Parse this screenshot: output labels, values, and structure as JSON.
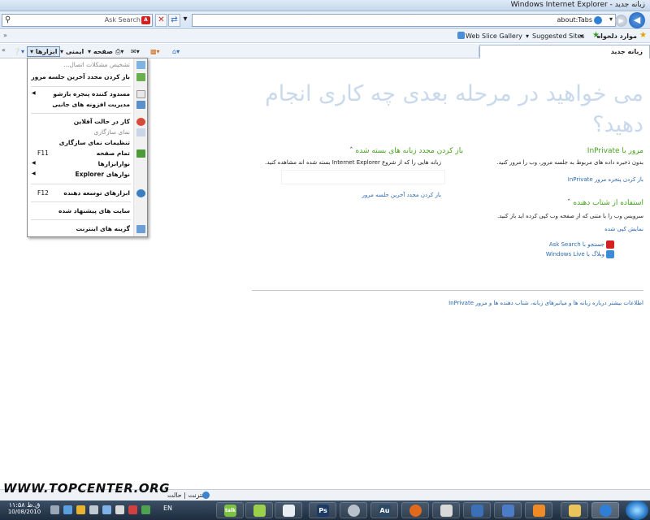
{
  "window": {
    "title": "زبانه جدید - Windows Internet Explorer"
  },
  "address_bar": {
    "url": "about:Tabs"
  },
  "search": {
    "provider": "Ask Search",
    "icon": "search-icon"
  },
  "favorites_bar": {
    "label": "موارد دلخواه",
    "items": [
      "Suggested Sites",
      "Web Slice Gallery"
    ]
  },
  "tab": {
    "title": "زبانه جدید"
  },
  "command_bar": {
    "page": "صفحه",
    "safety": "ایمنی",
    "tools": "ابزارها",
    "help_icon": "help-icon"
  },
  "tools_menu": {
    "items": [
      {
        "label": "تشخیص مشکلات اتصال...",
        "disabled": true
      },
      {
        "label": "باز کردن مجدد آخرین جلسه مرور"
      },
      {
        "label": "مسدود کننده پنجره بازشو",
        "submenu": true
      },
      {
        "label": "مدیریت افزونه های جانبی"
      },
      {
        "label": "کار در حالت آفلاین"
      },
      {
        "label": "نمای سازگاری",
        "disabled": true
      },
      {
        "label": "تنظیمات نمای سازگاری"
      },
      {
        "label": "تمام صفحه",
        "shortcut": "F11"
      },
      {
        "label": "نوارابزارها",
        "submenu": true
      },
      {
        "label": "نوارهای Explorer",
        "submenu": true
      },
      {
        "label": "ابزارهای توسعه دهنده",
        "shortcut": "F12"
      },
      {
        "label": "سایت های پیشنهاد شده"
      },
      {
        "label": "گزینه های اینترنت"
      }
    ]
  },
  "new_tab_page": {
    "heading": "می خواهید در مرحله بعدی چه کاری انجام دهید؟",
    "inprivate": {
      "title": "مرور با InPrivate",
      "body": "بدون ذخیره داده های مربوط به جلسه مرور، وب را مرور کنید.",
      "link": "باز کردن پنجره مرور InPrivate"
    },
    "reopen": {
      "title": "باز کردن مجدد زبانه های بسته شده",
      "body": "زبانه هایی را که از شروع Internet Explorer بسته شده اند مشاهده کنید.",
      "link": "باز کردن مجدد آخرین جلسه مرور"
    },
    "accelerators": {
      "title": "استفاده از شتاب دهنده",
      "body": "سرویس وب را با متنی که از صفحه وب کپی کرده اید باز کنید.",
      "link": "نمایش کپی شده",
      "services": [
        "جستجو با Ask Search",
        "وبلاگ با Windows Live"
      ]
    },
    "footer_link": "اطلاعات بیشتر درباره زبانه ها و میانبرهای زبانه، شتاب دهنده ها و مرور InPrivate"
  },
  "status_bar": {
    "text": "اینترنت | حالت"
  },
  "watermark": "WWW.TOPCENTER.ORG",
  "taskbar": {
    "time": "۱۱:۵۸ ق.ظ",
    "date": "10/08/2010",
    "language": "EN",
    "apps": [
      "talk",
      "Ps",
      "Au"
    ]
  },
  "colors": {
    "accent_green": "#46a21f",
    "link_blue": "#2b68b3",
    "heading_watermark": "#c9d9ec",
    "taskbar": "#1e2d3f"
  }
}
